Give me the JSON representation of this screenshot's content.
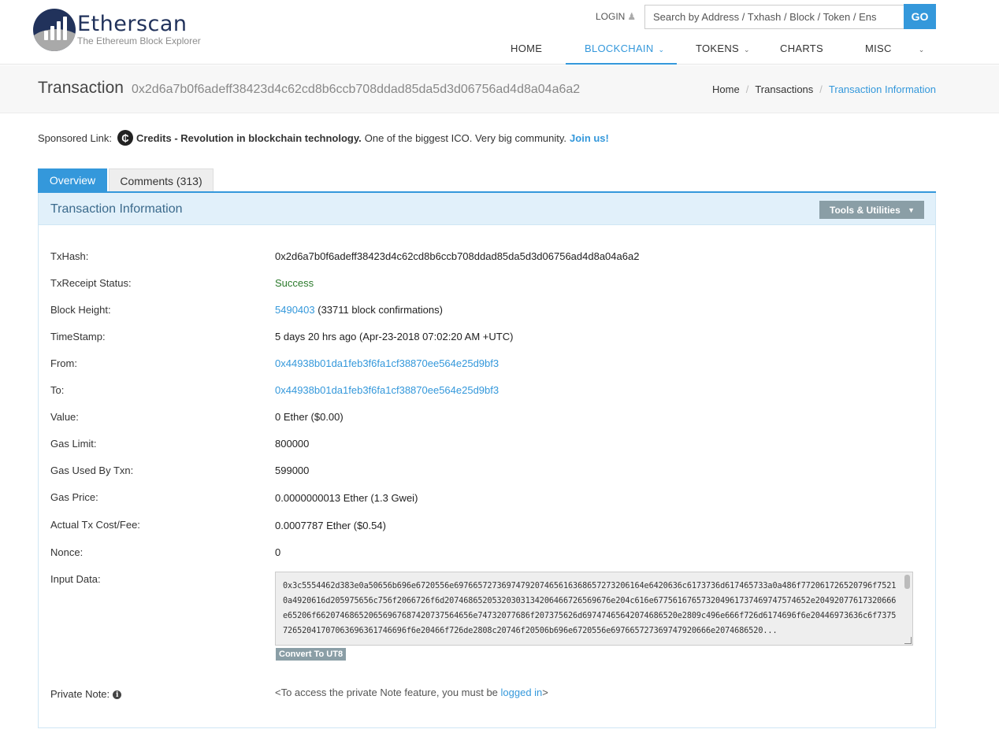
{
  "brand": {
    "title": "Etherscan",
    "subtitle": "The Ethereum Block Explorer"
  },
  "header": {
    "login_label": "LOGIN",
    "search_placeholder": "Search by Address / Txhash / Block / Token / Ens",
    "go_label": "GO",
    "nav": [
      {
        "label": "HOME",
        "active": false,
        "dropdown": false
      },
      {
        "label": "BLOCKCHAIN",
        "active": true,
        "dropdown": true
      },
      {
        "label": "TOKENS",
        "active": false,
        "dropdown": true
      },
      {
        "label": "CHARTS",
        "active": false,
        "dropdown": false
      },
      {
        "label": "MISC",
        "active": false,
        "dropdown": true
      }
    ]
  },
  "titlebar": {
    "title": "Transaction",
    "hash": "0x2d6a7b0f6adeff38423d4c62cd8b6ccb708ddad85da5d3d06756ad4d8a04a6a2",
    "breadcrumb": [
      "Home",
      "Transactions",
      "Transaction Information"
    ]
  },
  "sponsored": {
    "label": "Sponsored Link:",
    "icon_glyph": "₵",
    "bold_text": "Credits - Revolution in blockchain technology.",
    "text": "One of the biggest ICO. Very big community.",
    "link_text": "Join us!"
  },
  "tabs": {
    "overview": "Overview",
    "comments": "Comments (313)"
  },
  "panel": {
    "title": "Transaction Information",
    "tools_label": "Tools & Utilities"
  },
  "rows": {
    "txhash": {
      "label": "TxHash:",
      "value": "0x2d6a7b0f6adeff38423d4c62cd8b6ccb708ddad85da5d3d06756ad4d8a04a6a2"
    },
    "status": {
      "label": "TxReceipt Status:",
      "value": "Success"
    },
    "block": {
      "label": "Block Height:",
      "link": "5490403",
      "extra": " (33711 block confirmations)"
    },
    "timestamp": {
      "label": "TimeStamp:",
      "value": "5 days 20 hrs ago (Apr-23-2018 07:02:20 AM +UTC)"
    },
    "from": {
      "label": "From:",
      "value": "0x44938b01da1feb3f6fa1cf38870ee564e25d9bf3"
    },
    "to": {
      "label": "To:",
      "value": "0x44938b01da1feb3f6fa1cf38870ee564e25d9bf3"
    },
    "value": {
      "label": "Value:",
      "value": "0 Ether ($0.00)"
    },
    "gas_limit": {
      "label": "Gas Limit:",
      "value": "800000"
    },
    "gas_used": {
      "label": "Gas Used By Txn:",
      "value": "599000"
    },
    "gas_price": {
      "label": "Gas Price:",
      "value": "0.0000000013 Ether (1.3 Gwei)"
    },
    "fee": {
      "label": "Actual Tx Cost/Fee:",
      "value": "0.0007787 Ether ($0.54)"
    },
    "nonce": {
      "label": "Nonce:",
      "value": "0"
    },
    "input": {
      "label": "Input Data:",
      "value": "0x3c5554462d383e0a50656b696e6720556e6976657273697479207465616368657273206164e6420636c6173736d617465733a0a486f772061726520796f75210a4920616d205975656c756f2066726f6d20746865205320303134206466726569676e204c616e677561676573204961737469747574652e20492077617320666e65206f662074686520656967687420737564656e74732077686f207375626d69747465642074686520e2809c496e666f726d6174696f6e20446973636c6f737572652041707063696361746696f6e20466f726de2808c20746f20506b696e6720556e697665727369747920666e2074686520...",
      "convert_label": "Convert To UT8"
    },
    "note": {
      "label": "Private Note:",
      "prefix": "<To access the private Note feature, you must be ",
      "link": "logged in",
      "suffix": ">"
    }
  }
}
